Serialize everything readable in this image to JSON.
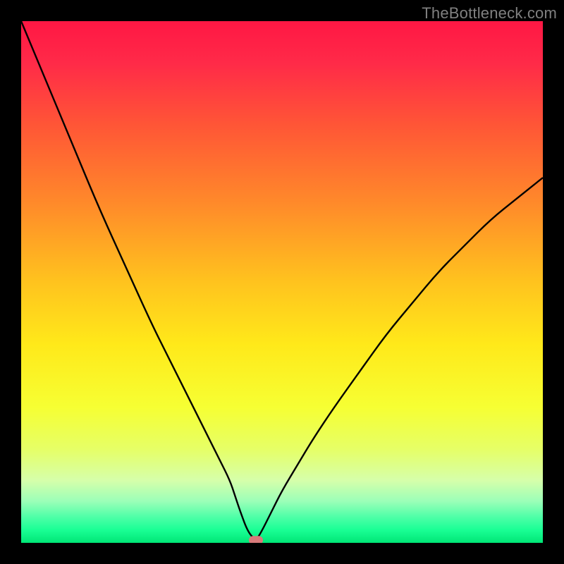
{
  "watermark": "TheBottleneck.com",
  "chart_data": {
    "type": "line",
    "title": "",
    "xlabel": "",
    "ylabel": "",
    "xlim": [
      0,
      100
    ],
    "ylim": [
      0,
      100
    ],
    "grid": false,
    "legend": false,
    "annotations": [],
    "background_gradient": {
      "stops": [
        {
          "pos": 0.0,
          "color": "#ff1744"
        },
        {
          "pos": 0.08,
          "color": "#ff2a48"
        },
        {
          "pos": 0.2,
          "color": "#ff5636"
        },
        {
          "pos": 0.35,
          "color": "#ff8a2a"
        },
        {
          "pos": 0.5,
          "color": "#ffc31e"
        },
        {
          "pos": 0.62,
          "color": "#ffe91a"
        },
        {
          "pos": 0.74,
          "color": "#f6ff33"
        },
        {
          "pos": 0.82,
          "color": "#e6ff66"
        },
        {
          "pos": 0.88,
          "color": "#d6ffaa"
        },
        {
          "pos": 0.92,
          "color": "#9cffb8"
        },
        {
          "pos": 0.95,
          "color": "#4fffa8"
        },
        {
          "pos": 0.975,
          "color": "#1aff95"
        },
        {
          "pos": 1.0,
          "color": "#00e676"
        }
      ]
    },
    "frame_color": "#000000",
    "series": [
      {
        "name": "bottleneck-curve",
        "color": "#000000",
        "stroke_width": 2.4,
        "x": [
          0,
          5,
          10,
          15,
          20,
          25,
          28,
          31,
          34,
          36,
          38,
          40,
          41,
          42,
          43.5,
          45,
          46,
          48,
          50,
          53,
          56,
          60,
          65,
          70,
          75,
          80,
          85,
          90,
          95,
          100
        ],
        "y": [
          100,
          88,
          76,
          64,
          53,
          42,
          36,
          30,
          24,
          20,
          16,
          12,
          9,
          6,
          2,
          0.5,
          2,
          6,
          10,
          15,
          20,
          26,
          33,
          40,
          46,
          52,
          57,
          62,
          66,
          70
        ]
      }
    ],
    "markers": [
      {
        "name": "optimal-marker",
        "shape": "rounded-rect",
        "x": 45,
        "y": 0.5,
        "color": "#d87a7a"
      }
    ]
  }
}
